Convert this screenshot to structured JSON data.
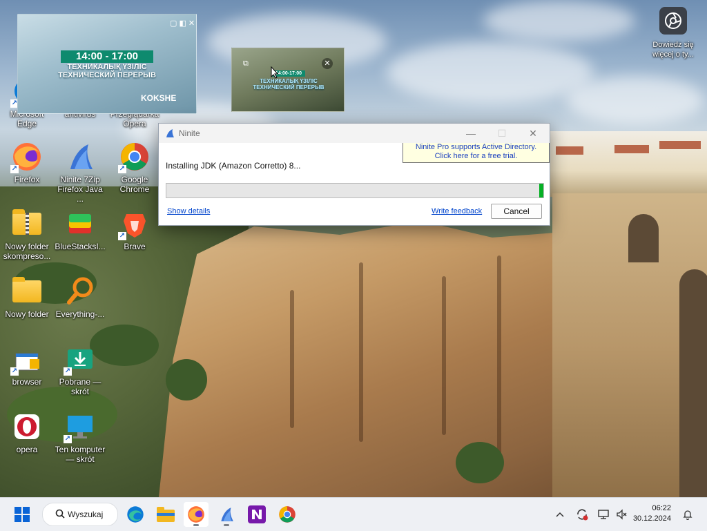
{
  "desktop": {
    "icons": [
      {
        "id": "edge",
        "label": "Microsoft Edge"
      },
      {
        "id": "antivirus",
        "label": "antivirus"
      },
      {
        "id": "opera-gx",
        "label": "Przeglądarka Opera"
      },
      {
        "id": "firefox",
        "label": "Firefox"
      },
      {
        "id": "ninite",
        "label": "Ninite 7Zip Firefox Java ..."
      },
      {
        "id": "chrome",
        "label": "Google Chrome"
      },
      {
        "id": "zip-folder",
        "label": "Nowy folder skompreso..."
      },
      {
        "id": "bluestacks",
        "label": "BlueStacksI..."
      },
      {
        "id": "brave",
        "label": "Brave"
      },
      {
        "id": "new-folder",
        "label": "Nowy folder"
      },
      {
        "id": "everything",
        "label": "Everything-..."
      },
      {
        "id": "browser",
        "label": "browser"
      },
      {
        "id": "pobrane",
        "label": "Pobrane — skrót"
      },
      {
        "id": "opera",
        "label": "opera"
      },
      {
        "id": "ten-komputer",
        "label": "Ten komputer — skrót"
      }
    ],
    "learn_more": {
      "label": "Dowiedz się więcej o ty..."
    }
  },
  "video_overlay": {
    "time": "14:00 - 17:00",
    "line1": "ТЕХНИКАЛЫҚ ҮЗІЛІС",
    "line2": "ТЕХНИЧЕСКИЙ ПЕРЕРЫВ",
    "logo": "KOKSHE",
    "small_time": "14:00-17:00",
    "small_line1": "ТЕХНИКАЛЫҚ ҮЗІЛІС",
    "small_line2": "ТЕХНИЧЕСКИЙ ПЕРЕРЫВ"
  },
  "ninite": {
    "title": "Ninite",
    "promo_line1": "Ninite Pro supports Active Directory.",
    "promo_line2": "Click here for a free trial.",
    "status": "Installing JDK (Amazon Corretto) 8...",
    "progress": 0.01,
    "show_details": "Show details",
    "write_feedback": "Write feedback",
    "cancel": "Cancel"
  },
  "taskbar": {
    "search_label": "Wyszukaj",
    "time": "06:22",
    "date": "30.12.2024",
    "pinned": [
      "start",
      "search",
      "edge",
      "file-explorer",
      "firefox",
      "ninite",
      "onenote",
      "chrome"
    ]
  },
  "colors": {
    "ninite_green": "#06b025",
    "promo_bg": "#ffffe1",
    "taskbar_bg": "#eef0f4"
  }
}
